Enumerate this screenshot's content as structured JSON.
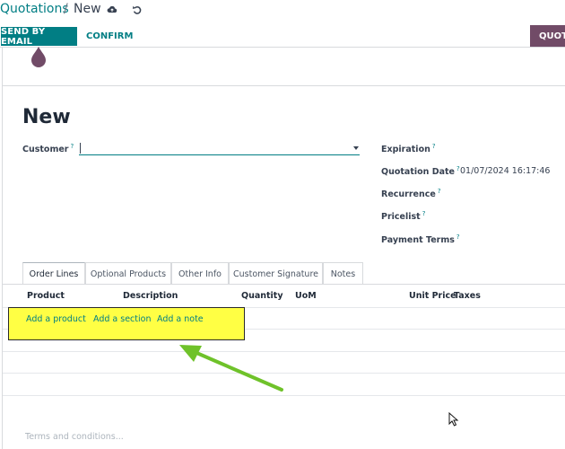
{
  "breadcrumb": {
    "parent": "Quotations",
    "separator": "/",
    "current": "New"
  },
  "toolbar": {
    "send_email": "SEND BY EMAIL",
    "confirm": "CONFIRM",
    "right_button": "QUOTA"
  },
  "form": {
    "title": "New",
    "customer_label": "Customer",
    "customer_value": "",
    "expiration_label": "Expiration",
    "quotation_date_label": "Quotation Date",
    "quotation_date_value": "01/07/2024 16:17:46",
    "recurrence_label": "Recurrence",
    "pricelist_label": "Pricelist",
    "payment_terms_label": "Payment Terms",
    "help_mark": "?"
  },
  "tabs": [
    "Order Lines",
    "Optional Products",
    "Other Info",
    "Customer Signature",
    "Notes"
  ],
  "table": {
    "headers": {
      "product": "Product",
      "description": "Description",
      "quantity": "Quantity",
      "uom": "UoM",
      "unit_price": "Unit Price",
      "taxes": "Taxes"
    },
    "add_product": "Add a product",
    "add_section": "Add a section",
    "add_note": "Add a note"
  },
  "terms_placeholder": "Terms and conditions...",
  "colors": {
    "accent": "#017e84",
    "brand": "#714b67",
    "highlight": "#ffff44",
    "annotation_arrow": "#6fc22a"
  },
  "icons": {
    "save": "cloud-upload-icon",
    "discard": "undo-icon"
  }
}
